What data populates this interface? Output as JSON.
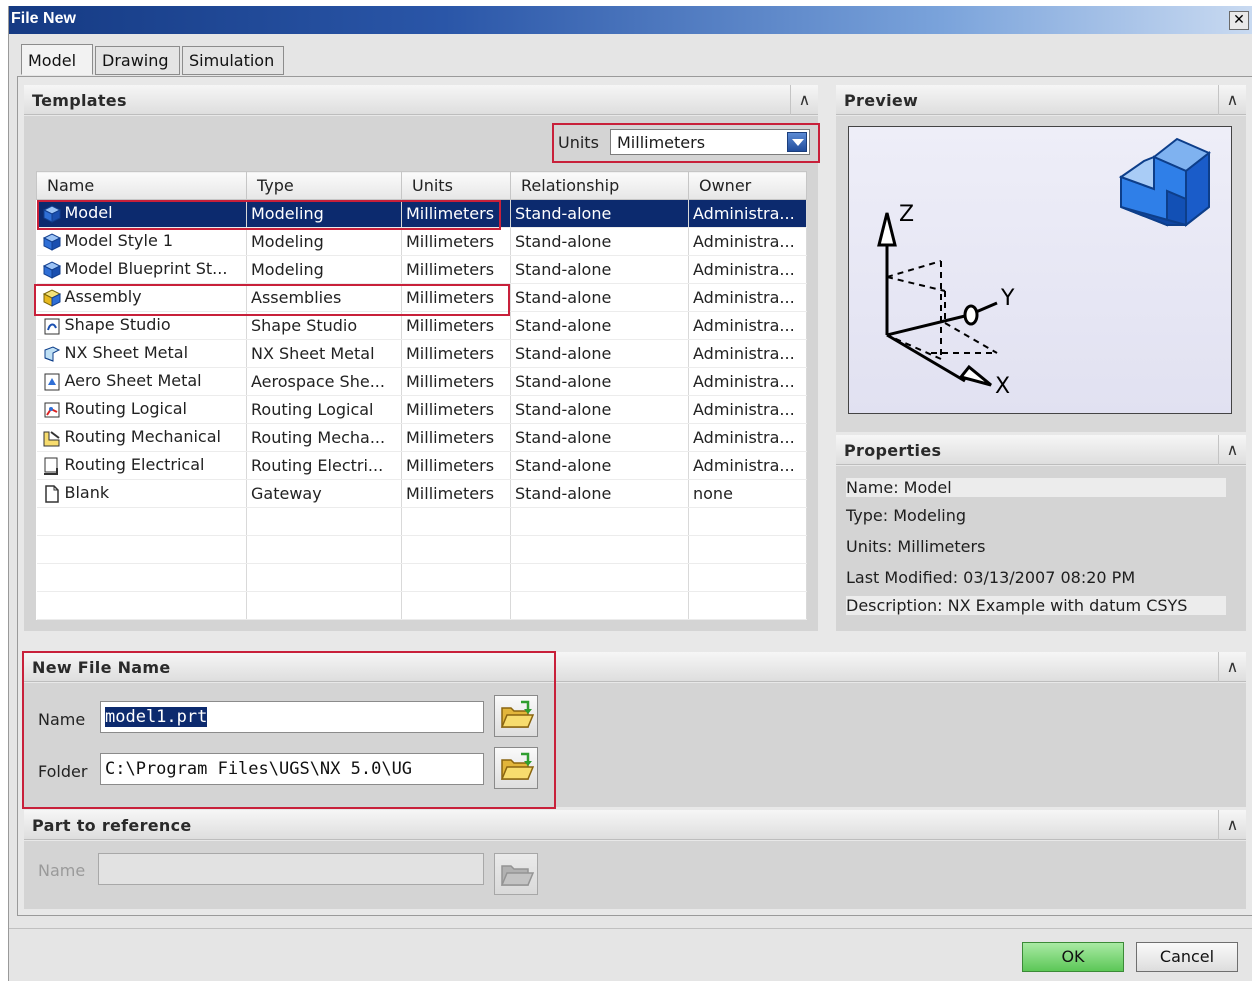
{
  "window": {
    "title": "File New",
    "close_symbol": "✕"
  },
  "tabs": [
    {
      "label": "Model",
      "active": true
    },
    {
      "label": "Drawing",
      "active": false
    },
    {
      "label": "Simulation",
      "active": false
    }
  ],
  "templates": {
    "title": "Templates",
    "collapse_symbol": "∧",
    "units_label": "Units",
    "units_value": "Millimeters",
    "columns": [
      "Name",
      "Type",
      "Units",
      "Relationship",
      "Owner"
    ],
    "rows": [
      {
        "icon": "model-icon",
        "name": "Model",
        "type": "Modeling",
        "units": "Millimeters",
        "relationship": "Stand-alone",
        "owner": "Administra...",
        "selected": true
      },
      {
        "icon": "model-icon",
        "name": "Model Style 1",
        "type": "Modeling",
        "units": "Millimeters",
        "relationship": "Stand-alone",
        "owner": "Administra..."
      },
      {
        "icon": "model-icon",
        "name": "Model Blueprint St...",
        "type": "Modeling",
        "units": "Millimeters",
        "relationship": "Stand-alone",
        "owner": "Administra..."
      },
      {
        "icon": "assembly-icon",
        "name": "Assembly",
        "type": "Assemblies",
        "units": "Millimeters",
        "relationship": "Stand-alone",
        "owner": "Administra..."
      },
      {
        "icon": "shape-studio-icon",
        "name": "Shape Studio",
        "type": "Shape Studio",
        "units": "Millimeters",
        "relationship": "Stand-alone",
        "owner": "Administra..."
      },
      {
        "icon": "sheet-metal-icon",
        "name": "NX Sheet Metal",
        "type": "NX Sheet Metal",
        "units": "Millimeters",
        "relationship": "Stand-alone",
        "owner": "Administra..."
      },
      {
        "icon": "aero-sheet-metal-icon",
        "name": "Aero Sheet Metal",
        "type": "Aerospace She...",
        "units": "Millimeters",
        "relationship": "Stand-alone",
        "owner": "Administra..."
      },
      {
        "icon": "routing-logical-icon",
        "name": "Routing Logical",
        "type": "Routing Logical",
        "units": "Millimeters",
        "relationship": "Stand-alone",
        "owner": "Administra..."
      },
      {
        "icon": "routing-mechanical-icon",
        "name": "Routing Mechanical",
        "type": "Routing Mecha...",
        "units": "Millimeters",
        "relationship": "Stand-alone",
        "owner": "Administra..."
      },
      {
        "icon": "routing-electrical-icon",
        "name": "Routing Electrical",
        "type": "Routing Electri...",
        "units": "Millimeters",
        "relationship": "Stand-alone",
        "owner": "Administra..."
      },
      {
        "icon": "blank-icon",
        "name": "Blank",
        "type": "Gateway",
        "units": "Millimeters",
        "relationship": "Stand-alone",
        "owner": "none"
      }
    ]
  },
  "preview": {
    "title": "Preview",
    "axis_labels": {
      "z": "Z",
      "y": "Y",
      "x": "X"
    }
  },
  "properties": {
    "title": "Properties",
    "lines": [
      "Name: Model",
      "Type: Modeling",
      "Units: Millimeters",
      "Last Modified: 03/13/2007 08:20 PM",
      "Description: NX Example with datum CSYS"
    ]
  },
  "new_file": {
    "title": "New File Name",
    "name_label": "Name",
    "name_value": "model1.prt",
    "folder_label": "Folder",
    "folder_value": "C:\\Program Files\\UGS\\NX 5.0\\UG"
  },
  "reference": {
    "title": "Part to reference",
    "name_label": "Name",
    "name_value": ""
  },
  "footer": {
    "ok_label": "OK",
    "cancel_label": "Cancel"
  },
  "colors": {
    "selection": "#0c2a6e",
    "highlight_box": "#c8203a",
    "ok_button": "#7fd67a",
    "cube": "#1e6fe0"
  }
}
